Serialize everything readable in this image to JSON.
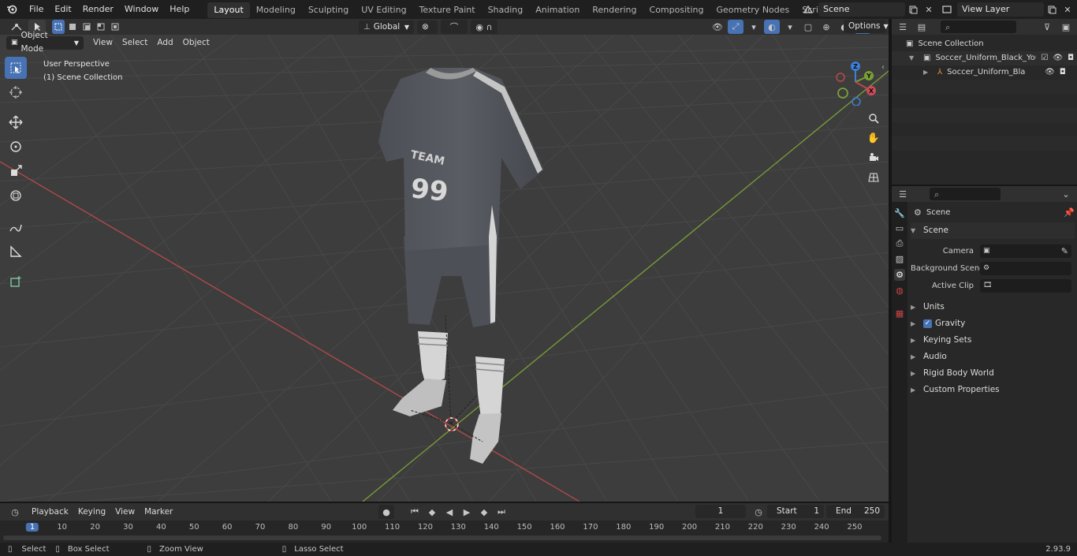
{
  "topbar": {
    "menus": [
      "File",
      "Edit",
      "Render",
      "Window",
      "Help"
    ],
    "workspace_tabs": [
      "Layout",
      "Modeling",
      "Sculpting",
      "UV Editing",
      "Texture Paint",
      "Shading",
      "Animation",
      "Rendering",
      "Compositing",
      "Geometry Nodes",
      "Scripting"
    ],
    "active_tab": "Layout",
    "scene_value": "Scene",
    "view_layer_value": "View Layer"
  },
  "viewport_header": {
    "mode": "Object Mode",
    "menus": [
      "View",
      "Select",
      "Add",
      "Object"
    ],
    "transform_orientation": "Global",
    "options_label": "Options"
  },
  "viewport": {
    "perspective_label": "User Perspective",
    "collection_label": "(1) Scene Collection",
    "shirt_text": "TEAM",
    "shirt_number": "99",
    "gizmo_labels": {
      "z": "Z",
      "y": "Y",
      "x": "X"
    }
  },
  "outliner": {
    "root": "Scene Collection",
    "item1": "Soccer_Uniform_Black_Your_T",
    "item2": "Soccer_Uniform_Black_Yo"
  },
  "properties": {
    "header_title": "Scene",
    "section_title": "Scene",
    "camera_label": "Camera",
    "background_scene_label": "Background Scene",
    "active_clip_label": "Active Clip",
    "panels": [
      "Units",
      "Gravity",
      "Keying Sets",
      "Audio",
      "Rigid Body World",
      "Custom Properties"
    ],
    "gravity_checked": true
  },
  "timeline": {
    "menus": [
      "Playback",
      "Keying",
      "View",
      "Marker"
    ],
    "current_frame": "1",
    "start_label": "Start",
    "start_value": "1",
    "end_label": "End",
    "end_value": "250",
    "ruler": [
      "1",
      "10",
      "20",
      "30",
      "40",
      "50",
      "60",
      "70",
      "80",
      "90",
      "100",
      "110",
      "120",
      "130",
      "140",
      "150",
      "160",
      "170",
      "180",
      "190",
      "200",
      "210",
      "220",
      "230",
      "240",
      "250"
    ]
  },
  "statusbar": {
    "select": "Select",
    "box_select": "Box Select",
    "zoom_view": "Zoom View",
    "lasso_select": "Lasso Select",
    "version": "2.93.9"
  },
  "colors": {
    "accent": "#4772b3",
    "x_axis": "#b84a4a",
    "y_axis": "#7aa035",
    "z_axis": "#3d7fd9"
  }
}
